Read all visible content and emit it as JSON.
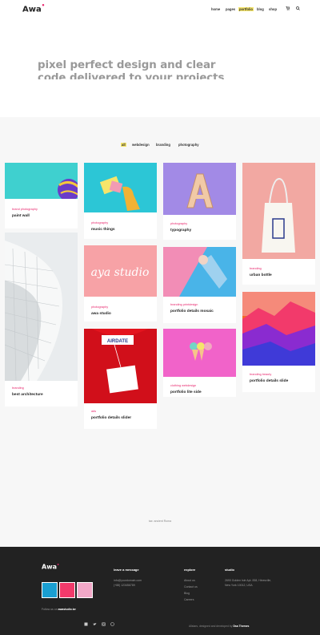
{
  "header": {
    "logo": "Awa",
    "logo_dot": "•",
    "nav": [
      "home",
      "pages",
      "portfolio",
      "blog",
      "shop"
    ],
    "cart_icon": "cart-icon",
    "search_icon": "search-icon"
  },
  "hero": {
    "line1": "pixel perfect design and clear",
    "line2": "code delivered to your projects"
  },
  "filters": [
    "all",
    "webdesign",
    "branding",
    "photography"
  ],
  "cards": [
    {
      "cat": "brand photography",
      "title": "paint wall"
    },
    {
      "cat": "photography",
      "title": "music things"
    },
    {
      "cat": "photography",
      "title": "typography"
    },
    {
      "cat": "branding",
      "title": "urban bottle"
    },
    {
      "cat": "branding",
      "title": "best architecture"
    },
    {
      "cat": "photography",
      "title": "awa studio"
    },
    {
      "cat": "branding printdesign",
      "title": "portfolio details mosaic"
    },
    {
      "cat": "branding beauty",
      "title": "portfolio details slide"
    },
    {
      "cat": "ads",
      "title": "portfolio details slider"
    },
    {
      "cat": "clothing webdesign",
      "title": "portfolio lite side"
    }
  ],
  "card_art": {
    "card6": "aya studio",
    "card9_tag": "AIRDATE"
  },
  "credit": "tax: ancient Roma",
  "footer": {
    "logo": "Awa",
    "col1_head": "leave a message",
    "col1_lines": [
      "info@yourdomain.com",
      "(+88) 123456789"
    ],
    "col2_head": "explore",
    "col2_lines": [
      "About us",
      "Contact us",
      "Blog",
      "Careers"
    ],
    "col3_head": "studio",
    "col3_lines": [
      "2690 Golden Isle Apt. 838, Hinesville,",
      "New York 10012, USA"
    ],
    "follow_prefix": "Follow us on",
    "follow_handle": "awastudio.tw",
    "copyright_prefix": "Allstars, designed and developed by",
    "copyright_author": "Dsa Themes",
    "social": [
      "facebook-icon",
      "twitter-icon",
      "instagram-icon",
      "dribbble-icon"
    ]
  },
  "colors": {
    "accent": "#e8266d",
    "highlight": "#f5e56b",
    "footer_bg": "#222222",
    "portfolio_bg": "#f7f7f7"
  }
}
